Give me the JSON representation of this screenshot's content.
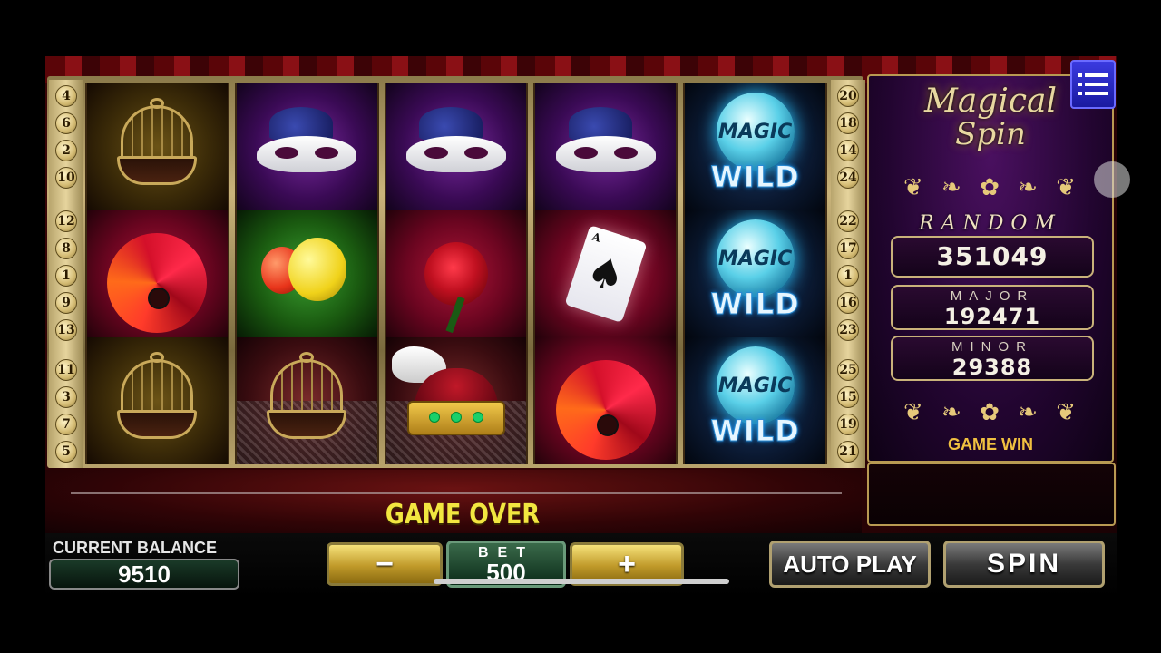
{
  "game": {
    "logo_line1": "Magical",
    "logo_line2": "Spin",
    "jackpot_label": "RANDOM",
    "random_value": "351049",
    "major_label": "MAJOR",
    "major_value": "192471",
    "minor_label": "MINOR",
    "minor_value": "29388",
    "game_win_label": "GAME WIN",
    "message": "GAME OVER"
  },
  "paylines": {
    "left": [
      "4",
      "6",
      "2",
      "10",
      "12",
      "8",
      "1",
      "9",
      "13",
      "11",
      "3",
      "7",
      "5"
    ],
    "right": [
      "20",
      "18",
      "14",
      "24",
      "22",
      "17",
      "1",
      "16",
      "23",
      "25",
      "15",
      "19",
      "21"
    ]
  },
  "reels": [
    [
      "cage-icon",
      "fan-icon",
      "cage-icon"
    ],
    [
      "mask-icon",
      "balloons-icon",
      "cage-icon"
    ],
    [
      "mask-icon",
      "rose-icon",
      "crown-icon"
    ],
    [
      "mask-icon",
      "ace-of-spades-icon",
      "fan-icon"
    ],
    [
      "wild-icon",
      "wild-icon",
      "wild-icon"
    ]
  ],
  "wild": {
    "orb_text": "MAGIC",
    "text": "WILD"
  },
  "card": {
    "rank": "A",
    "suit": "♠"
  },
  "controls": {
    "balance_label": "CURRENT BALANCE",
    "balance_value": "9510",
    "minus_label": "−",
    "plus_label": "+",
    "bet_label": "BET",
    "bet_value": "500",
    "auto_play_label": "AUTO PLAY",
    "spin_label": "SPIN"
  },
  "colors": {
    "accent_gold": "#f2e640",
    "menu_blue": "#2a2ad0",
    "panel_purple": "#220530"
  }
}
